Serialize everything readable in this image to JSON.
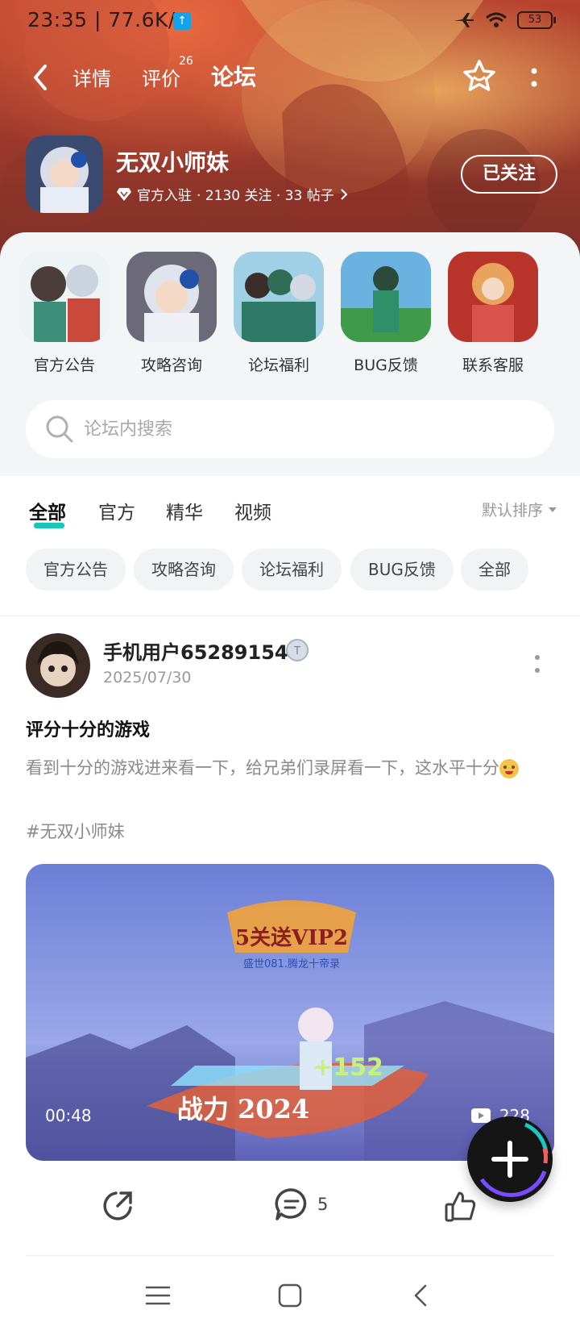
{
  "status_bar": {
    "time_speed": "23:35 | 77.6K/s",
    "battery": "53",
    "upload_icon": "upload-arrow-icon"
  },
  "nav": {
    "tabs": [
      {
        "label": "详情"
      },
      {
        "label": "评价",
        "badge": "26"
      },
      {
        "label": "论坛",
        "active": true
      }
    ],
    "icons": [
      "back-arrow-icon",
      "star-favorite-icon",
      "more-vertical-icon"
    ]
  },
  "game": {
    "name": "无双小师妹",
    "official_label": "官方入驻",
    "meta_stats": "· 2130 关注 · 33 帖子",
    "follow_label": "已关注"
  },
  "categories": [
    {
      "label": "官方公告"
    },
    {
      "label": "攻略咨询"
    },
    {
      "label": "论坛福利"
    },
    {
      "label": "BUG反馈"
    },
    {
      "label": "联系客服"
    }
  ],
  "search": {
    "placeholder": "论坛内搜索"
  },
  "filter_tabs": [
    {
      "label": "全部",
      "active": true
    },
    {
      "label": "官方"
    },
    {
      "label": "精华"
    },
    {
      "label": "视频"
    }
  ],
  "sort_label": "默认排序",
  "chips": [
    {
      "label": "官方公告"
    },
    {
      "label": "攻略咨询"
    },
    {
      "label": "论坛福利"
    },
    {
      "label": "BUG反馈"
    },
    {
      "label": "全部"
    }
  ],
  "post": {
    "username": "手机用户65289154",
    "date": "2025/07/30",
    "title": "评分十分的游戏",
    "body": "看到十分的游戏进来看一下，给兄弟们录屏看一下，这水平十分",
    "tag": "#无双小师妹",
    "video": {
      "duration": "00:48",
      "views": "228",
      "overlay_title": "5关送VIP2",
      "overlay_sub": "盛世081.腾龙十帝录",
      "overlay_power": "战力 2024",
      "overlay_bonus": "+152"
    },
    "comment_count": "5"
  },
  "colors": {
    "accent": "#18c7b5",
    "header_bg": "#a83e2e"
  }
}
